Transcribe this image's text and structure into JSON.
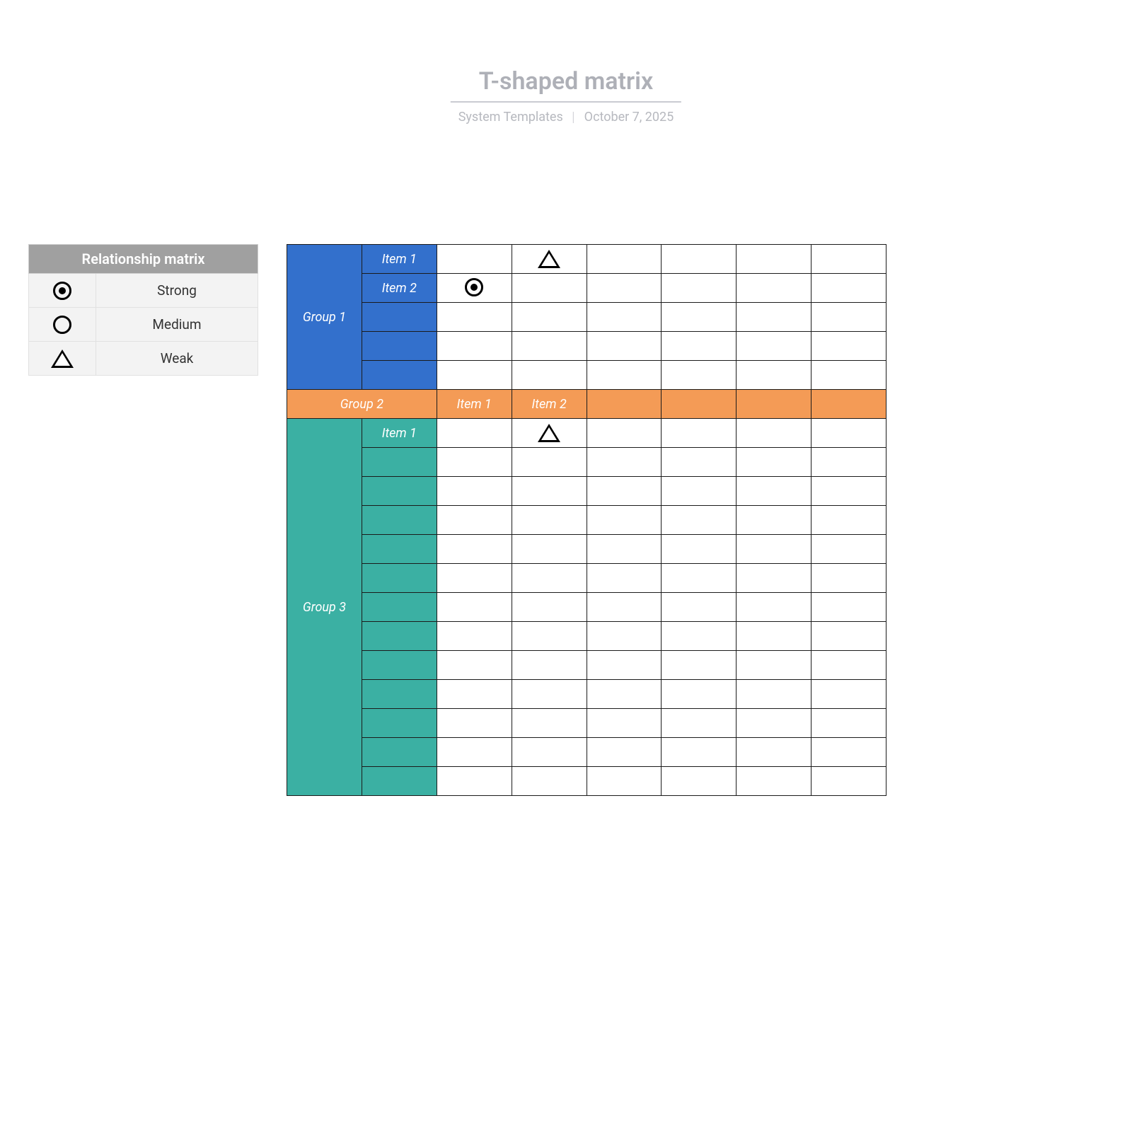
{
  "header": {
    "title": "T-shaped matrix",
    "byline_left": "System Templates",
    "byline_right": "October 7, 2025"
  },
  "legend": {
    "title": "Relationship matrix",
    "rows": [
      {
        "symbol": "strong",
        "label": "Strong"
      },
      {
        "symbol": "medium",
        "label": "Medium"
      },
      {
        "symbol": "weak",
        "label": "Weak"
      }
    ]
  },
  "colors": {
    "group1": "#3370cc",
    "group2": "#f49b56",
    "group3": "#3bb0a3"
  },
  "matrix": {
    "columns": 6,
    "group1": {
      "label": "Group 1",
      "rows": 5,
      "items": [
        "Item 1",
        "Item 2",
        "",
        "",
        ""
      ]
    },
    "group2": {
      "label": "Group 2",
      "items": [
        "Item 1",
        "Item 2",
        "",
        "",
        "",
        ""
      ]
    },
    "group3": {
      "label": "Group 3",
      "rows": 13,
      "items": [
        "Item 1",
        "",
        "",
        "",
        "",
        "",
        "",
        "",
        "",
        "",
        "",
        "",
        ""
      ]
    },
    "marks": {
      "group1": [
        {
          "row": 0,
          "col": 1,
          "symbol": "weak"
        },
        {
          "row": 1,
          "col": 0,
          "symbol": "strong"
        }
      ],
      "group3": [
        {
          "row": 0,
          "col": 1,
          "symbol": "weak"
        }
      ]
    }
  }
}
